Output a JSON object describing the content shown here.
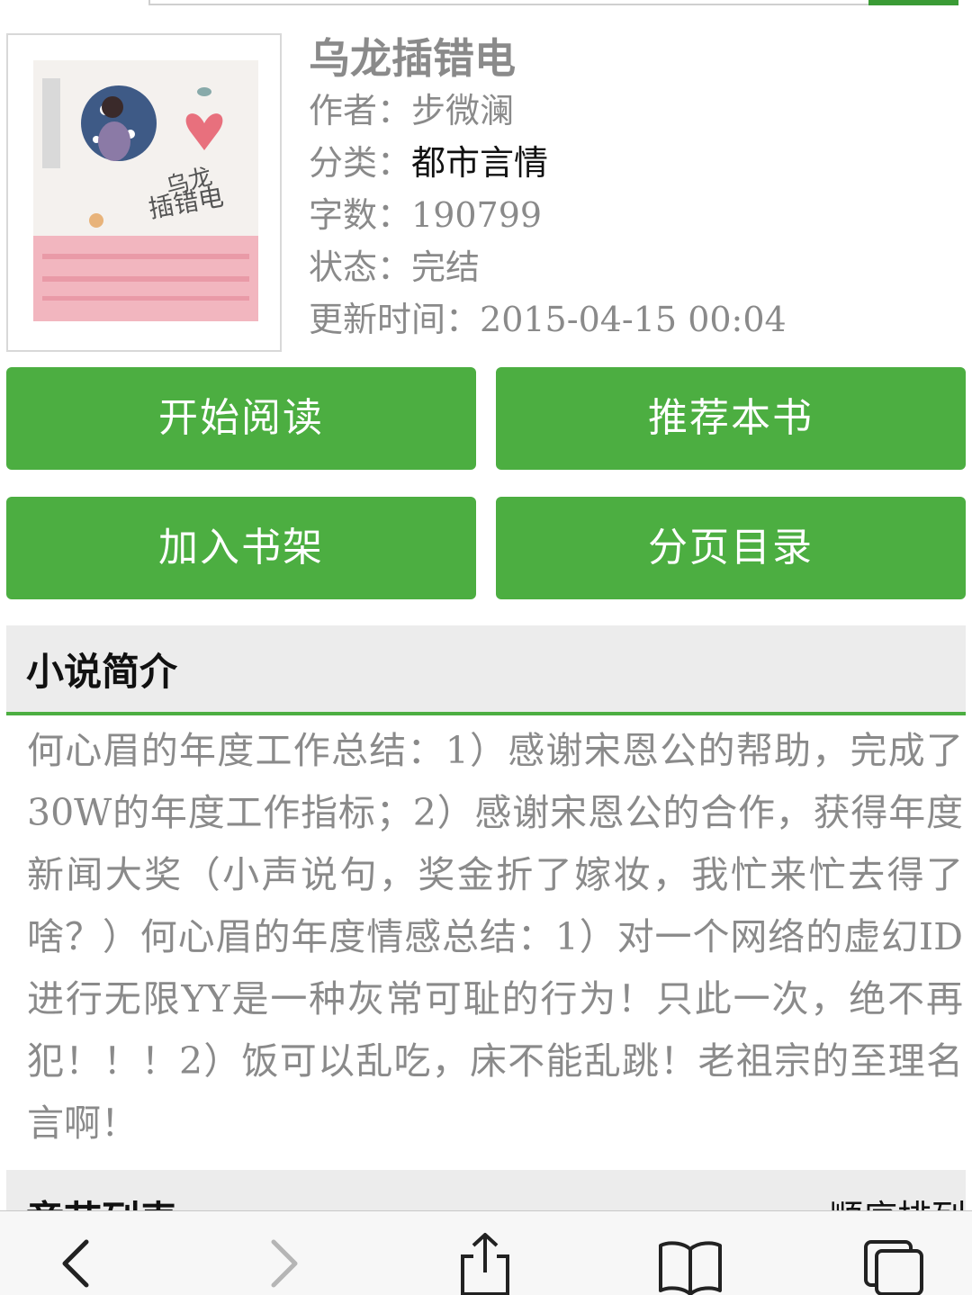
{
  "book": {
    "title": "乌龙插错电",
    "author_label": "作者：",
    "author": "步微澜",
    "category_label": "分类：",
    "category": "都市言情",
    "words_label": "字数：",
    "words": "190799",
    "status_label": "状态：",
    "status": "完结",
    "updated_label": "更新时间：",
    "updated": "2015-04-15 00:04",
    "cover_alt": "乌龙插错电"
  },
  "actions": {
    "start_reading": "开始阅读",
    "recommend": "推荐本书",
    "add_shelf": "加入书架",
    "paged_toc": "分页目录"
  },
  "intro": {
    "heading": "小说简介",
    "text": "何心眉的年度工作总结：1）感谢宋恩公的帮助，完成了30W的年度工作指标；2）感谢宋恩公的合作，获得年度新闻大奖（小声说句，奖金折了嫁妆，我忙来忙去得了啥？）何心眉的年度情感总结：1）对一个网络的虚幻ID进行无限YY是一种灰常可耻的行为！只此一次，绝不再犯！！！2）饭可以乱吃，床不能乱跳！老祖宗的至理名言啊！"
  },
  "chapters": {
    "heading": "章节列表",
    "sort_label": "顺序排列"
  },
  "colors": {
    "accent": "#4cae41",
    "muted_text": "#8a8a8a",
    "section_bg": "#ececec"
  },
  "browser_toolbar": [
    "back-icon",
    "forward-icon",
    "share-icon",
    "bookmarks-icon",
    "tabs-icon"
  ]
}
